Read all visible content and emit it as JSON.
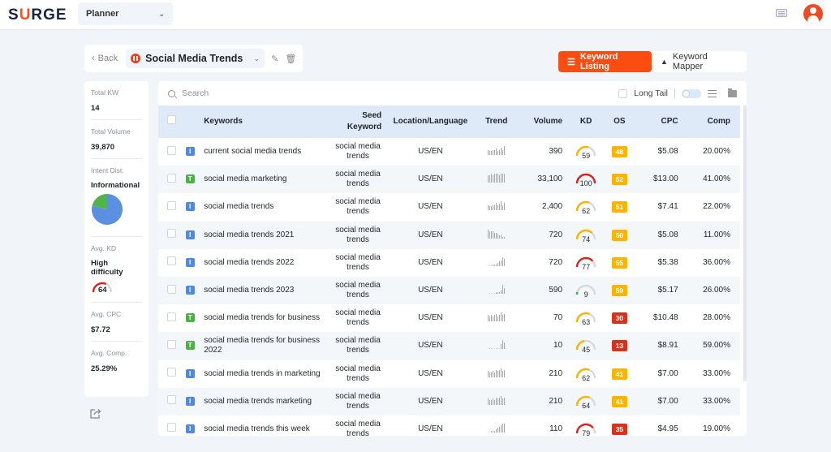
{
  "header": {
    "logo": {
      "pre": "S",
      "mid": "U",
      "post": "RGE"
    },
    "app_select": "Planner",
    "keyboard_icon": "keyboard-icon",
    "avatar_icon": "user-icon"
  },
  "project": {
    "back_label": "Back",
    "name": "Social Media Trends",
    "edit_icon": "pencil-icon",
    "delete_icon": "trash-icon"
  },
  "views": {
    "active": "Keyword Listing",
    "inactive": "Keyword Mapper"
  },
  "stats": {
    "total_kw_label": "Total KW",
    "total_kw": "14",
    "total_volume_label": "Total Volume",
    "total_volume": "39,870",
    "intent_label": "Intent Dist.",
    "intent_value": "Informational",
    "intent_distribution": {
      "informational": 0.79,
      "transactional": 0.21
    },
    "avg_kd_label": "Avg. KD",
    "avg_kd_text": "High difficulty",
    "avg_kd": 64,
    "avg_cpc_label": "Avg. CPC",
    "avg_cpc": "$7.72",
    "avg_comp_label": "Avg. Comp.",
    "avg_comp": "25.29%"
  },
  "toolbar": {
    "search_placeholder": "Search",
    "long_tail_label": "Long Tail"
  },
  "colors": {
    "brand": "#fb4c12",
    "kd_easy": "#2fb344",
    "kd_medium": "#fbb500",
    "kd_hard": "#d9261c",
    "os_yellow": "#fbb500",
    "os_red": "#d9321c"
  },
  "table": {
    "columns": [
      "Keywords",
      "Seed Keyword",
      "Location/Language",
      "Trend",
      "Volume",
      "KD",
      "OS",
      "CPC",
      "Comp"
    ],
    "rows": [
      {
        "intent": "I",
        "keyword": "current social media trends",
        "seed": "social media trends",
        "loc": "US/EN",
        "trend": [
          4,
          3,
          3,
          4,
          4,
          5,
          3,
          4,
          6,
          4,
          7
        ],
        "volume": "390",
        "kd": 59,
        "os": "48",
        "cpc": "$5.08",
        "comp": "20.00%"
      },
      {
        "intent": "T",
        "keyword": "social media marketing",
        "seed": "social media trends",
        "loc": "US/EN",
        "trend": [
          5,
          5,
          6,
          5,
          6,
          6,
          6,
          5,
          6,
          6,
          6
        ],
        "volume": "33,100",
        "kd": 100,
        "os": "52",
        "cpc": "$13.00",
        "comp": "41.00%"
      },
      {
        "intent": "I",
        "keyword": "social media trends",
        "seed": "social media trends",
        "loc": "US/EN",
        "trend": [
          4,
          3,
          3,
          4,
          4,
          6,
          4,
          5,
          7,
          4,
          6
        ],
        "volume": "2,400",
        "kd": 62,
        "os": "51",
        "cpc": "$7.41",
        "comp": "22.00%"
      },
      {
        "intent": "I",
        "keyword": "social media trends 2021",
        "seed": "social media trends",
        "loc": "US/EN",
        "trend": [
          6,
          5,
          5,
          5,
          4,
          4,
          3,
          2,
          2,
          1,
          1
        ],
        "volume": "720",
        "kd": 74,
        "os": "50",
        "cpc": "$5.08",
        "comp": "11.00%"
      },
      {
        "intent": "I",
        "keyword": "social media trends 2022",
        "seed": "social media trends",
        "loc": "US/EN",
        "trend": [
          0,
          0,
          0,
          1,
          1,
          1,
          2,
          3,
          4,
          6,
          5
        ],
        "volume": "720",
        "kd": 77,
        "os": "55",
        "cpc": "$5.38",
        "comp": "36.00%"
      },
      {
        "intent": "I",
        "keyword": "social media trends 2023",
        "seed": "social media trends",
        "loc": "US/EN",
        "trend": [
          0,
          0,
          0,
          0,
          0,
          1,
          1,
          1,
          2,
          5,
          3
        ],
        "volume": "590",
        "kd": 9,
        "os": "59",
        "cpc": "$5.17",
        "comp": "26.00%"
      },
      {
        "intent": "T",
        "keyword": "social media trends for business",
        "seed": "social media trends",
        "loc": "US/EN",
        "trend": [
          5,
          4,
          5,
          4,
          5,
          6,
          4,
          5,
          7,
          5,
          6
        ],
        "volume": "70",
        "kd": 63,
        "os": "30",
        "cpc": "$10.48",
        "comp": "28.00%"
      },
      {
        "intent": "T",
        "keyword": "social media trends for business 2022",
        "seed": "social media trends",
        "loc": "US/EN",
        "trend": [
          0,
          0,
          0,
          0,
          0,
          0,
          0,
          0,
          4,
          7,
          5
        ],
        "volume": "10",
        "kd": 45,
        "os": "13",
        "cpc": "$8.91",
        "comp": "59.00%"
      },
      {
        "intent": "I",
        "keyword": "social media trends in marketing",
        "seed": "social media trends",
        "loc": "US/EN",
        "trend": [
          5,
          4,
          4,
          5,
          4,
          6,
          5,
          6,
          7,
          5,
          6
        ],
        "volume": "210",
        "kd": 62,
        "os": "41",
        "cpc": "$7.00",
        "comp": "33.00%"
      },
      {
        "intent": "I",
        "keyword": "social media trends marketing",
        "seed": "social media trends",
        "loc": "US/EN",
        "trend": [
          5,
          4,
          4,
          5,
          4,
          6,
          5,
          6,
          7,
          5,
          6
        ],
        "volume": "210",
        "kd": 64,
        "os": "41",
        "cpc": "$7.00",
        "comp": "33.00%"
      },
      {
        "intent": "I",
        "keyword": "social media trends this week",
        "seed": "social media trends",
        "loc": "US/EN",
        "trend": [
          0,
          0,
          1,
          1,
          1,
          2,
          3,
          4,
          5,
          6,
          6
        ],
        "volume": "110",
        "kd": 79,
        "os": "35",
        "cpc": "$4.95",
        "comp": "19.00%"
      }
    ]
  }
}
